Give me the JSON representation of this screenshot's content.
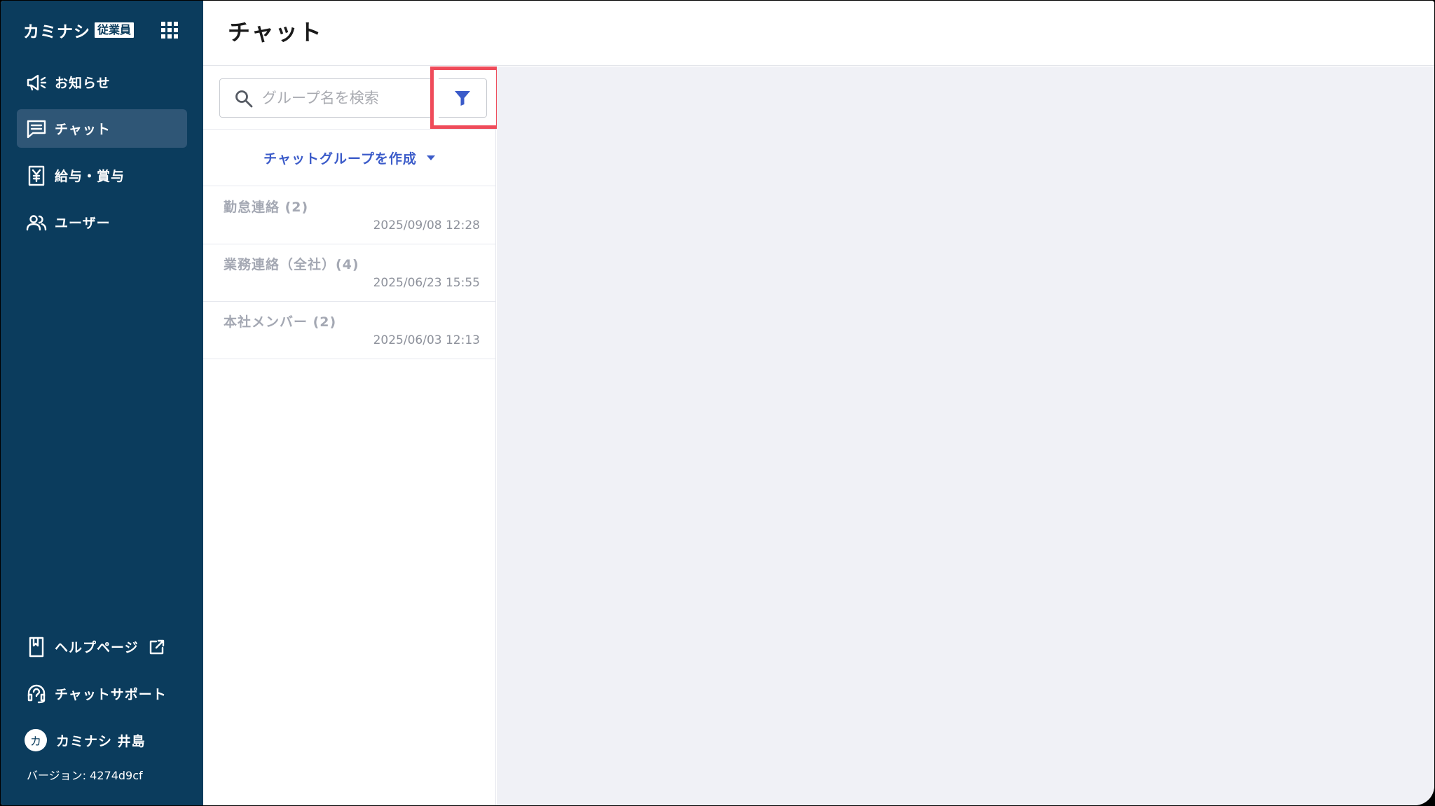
{
  "app": {
    "logo_text": "カミナシ",
    "logo_badge": "従業員"
  },
  "sidebar": {
    "items": [
      {
        "label": "お知らせ",
        "icon": "megaphone-icon"
      },
      {
        "label": "チャット",
        "icon": "chat-icon",
        "active": true
      },
      {
        "label": "給与・賞与",
        "icon": "payslip-icon"
      },
      {
        "label": "ユーザー",
        "icon": "users-icon"
      }
    ],
    "help_label": "ヘルプページ",
    "support_label": "チャットサポート",
    "user": {
      "avatar_initial": "カ",
      "name": "カミナシ 井島"
    },
    "version_text": "バージョン: 4274d9cf"
  },
  "header": {
    "title": "チャット"
  },
  "search": {
    "placeholder": "グループ名を検索",
    "value": ""
  },
  "create_group_label": "チャットグループを作成",
  "chats": [
    {
      "name": "勤怠連絡 (2)",
      "time": "2025/09/08 12:28"
    },
    {
      "name": "業務連絡（全社）(4)",
      "time": "2025/06/23 15:55"
    },
    {
      "name": "本社メンバー (2)",
      "time": "2025/06/03 12:13"
    }
  ],
  "colors": {
    "sidebar_bg": "#0b3c5d",
    "sidebar_active": "#2f5676",
    "accent_blue": "#3b5bc9",
    "highlight_red": "#ef4b5a",
    "main_bg": "#f0f1f6"
  }
}
